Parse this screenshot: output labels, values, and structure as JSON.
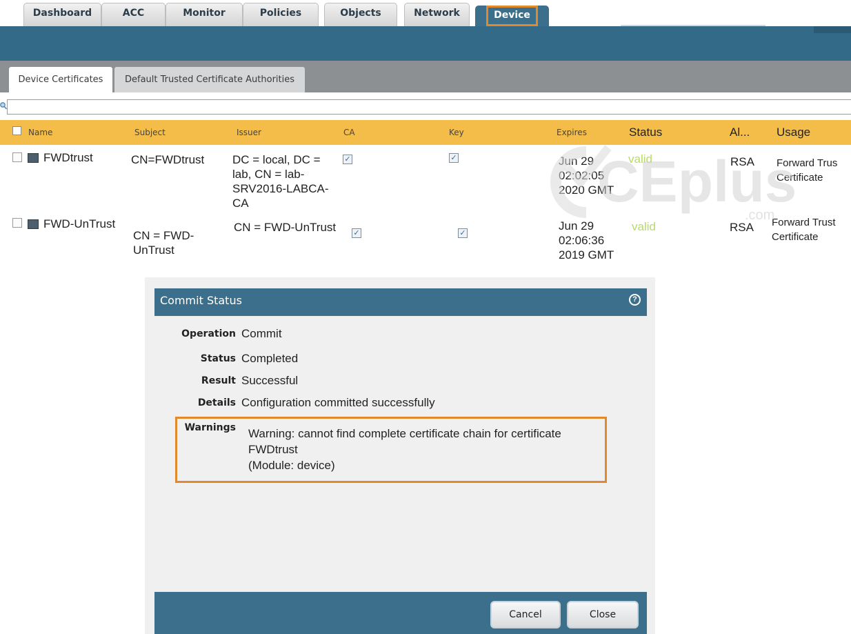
{
  "nav": {
    "tabs": [
      "Dashboard",
      "ACC",
      "Monitor",
      "Policies",
      "Objects",
      "Network"
    ],
    "active_tab": "Device"
  },
  "subtabs": {
    "active": "Device Certificates",
    "inactive": "Default Trusted Certificate Authorities"
  },
  "search": {
    "placeholder": "",
    "value": ""
  },
  "table": {
    "headers": {
      "name": "Name",
      "subject": "Subject",
      "issuer": "Issuer",
      "ca": "CA",
      "key": "Key",
      "expires": "Expires",
      "status": "Status",
      "algorithm": "Al...",
      "usage": "Usage"
    },
    "rows": [
      {
        "name": "FWDtrust",
        "subject": "CN=FWDtrust",
        "issuer": "DC = local, DC =\nlab, CN = lab-\nSRV2016-LABCA-\nCA",
        "ca": true,
        "key": true,
        "expires": "Jun 29\n02:02:05\n2020 GMT",
        "status": "valid",
        "algorithm": "RSA",
        "usage": "Forward Trus\nCertificate"
      },
      {
        "name": "FWD-UnTrust",
        "subject": "CN = FWD-\nUnTrust",
        "issuer": "CN = FWD-UnTrust",
        "ca": true,
        "key": true,
        "expires": "Jun 29\n02:06:36\n2019 GMT",
        "status": "valid",
        "algorithm": "RSA",
        "usage": "Forward Trust\nCertificate"
      }
    ]
  },
  "watermark": {
    "text": "CEplus",
    "sub": ".com"
  },
  "modal": {
    "title": "Commit Status",
    "help_icon": "help-icon",
    "fields": [
      {
        "label": "Operation",
        "value": "Commit"
      },
      {
        "label": "Status",
        "value": "Completed"
      },
      {
        "label": "Result",
        "value": "Successful"
      },
      {
        "label": "Details",
        "value": "Configuration committed successfully"
      }
    ],
    "warnings_label": "Warnings",
    "warnings_text": "Warning: cannot find complete certificate chain for certificate\nFWDtrust\n(Module: device)",
    "cancel_label": "Cancel",
    "close_label": "Close"
  },
  "colors": {
    "nav_blue": "#336a88",
    "header_orange": "#f4bd4a",
    "highlight_orange": "#e08a2c",
    "valid_green": "#b7dc64"
  }
}
